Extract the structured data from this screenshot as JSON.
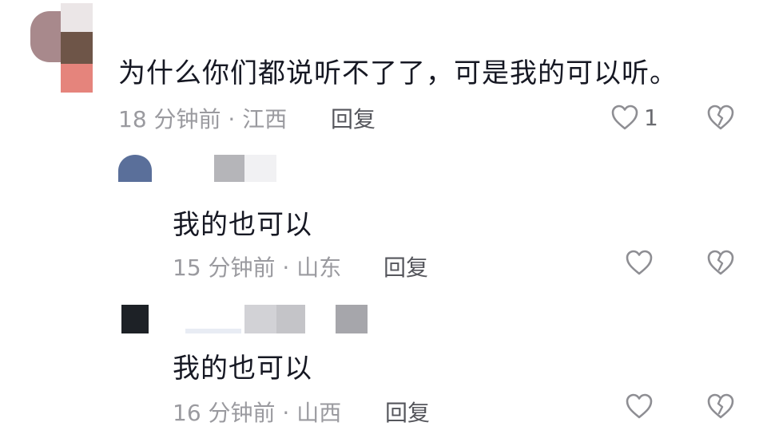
{
  "comments": [
    {
      "text": "为什么你们都说听不了了，可是我的可以听。",
      "meta": "18 分钟前 · 江西",
      "reply_label": "回复",
      "likes": "1"
    },
    {
      "text": "我的也可以",
      "meta": "15 分钟前 · 山东",
      "reply_label": "回复"
    },
    {
      "text": "我的也可以",
      "meta": "16 分钟前 · 山西",
      "reply_label": "回复"
    }
  ],
  "icons": {
    "like": "heart-outline-icon",
    "dislike": "broken-heart-icon"
  },
  "colors": {
    "text": "#161823",
    "meta": "#9a9a9f",
    "reply": "#55565c",
    "icon": "#8e8e93"
  }
}
